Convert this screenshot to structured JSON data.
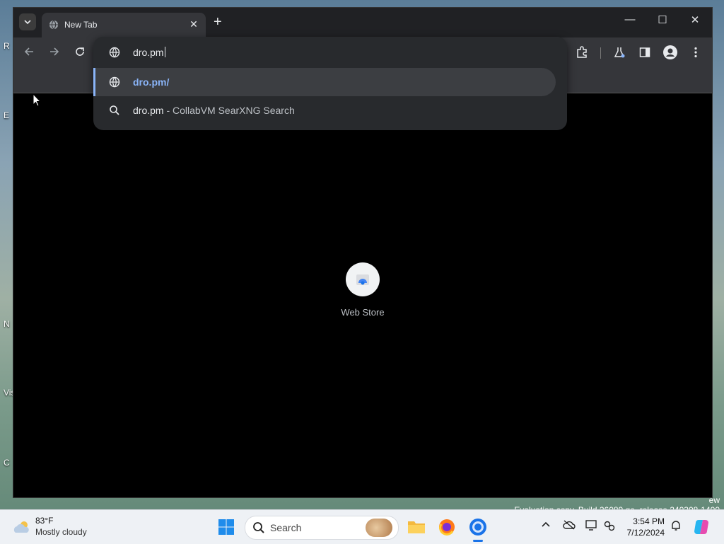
{
  "desktop": {
    "left_labels": [
      "R",
      "E",
      "N",
      "Vis",
      "C"
    ]
  },
  "browser": {
    "tab": {
      "title": "New Tab",
      "close_glyph": "✕"
    },
    "new_tab_glyph": "+",
    "window_controls": {
      "minimize": "—",
      "maximize": "☐",
      "close": "✕"
    },
    "omnibox": {
      "value": "dro.pm",
      "suggestions": [
        {
          "text": "dro.pm/",
          "kind": "url",
          "icon": "globe-icon"
        },
        {
          "text": "dro.pm",
          "sub": " - CollabVM SearXNG Search",
          "kind": "search",
          "icon": "search-icon"
        }
      ]
    },
    "shortcut": {
      "label": "Web Store",
      "icon": "web-store-icon"
    }
  },
  "watermark": {
    "line1": "ew",
    "line2": "Evaluation copy. Build 26080.ge_release.240308-1400"
  },
  "taskbar": {
    "weather": {
      "temp": "83°F",
      "condition": "Mostly cloudy",
      "icon": "cloud-icon"
    },
    "search_label": "Search",
    "clock": {
      "time": "3:54 PM",
      "date": "7/12/2024"
    }
  },
  "colors": {
    "accent": "#8ab4f8",
    "window_bg": "#000000",
    "toolbar_bg": "#35363a",
    "omnibox_bg": "#282a2d"
  }
}
